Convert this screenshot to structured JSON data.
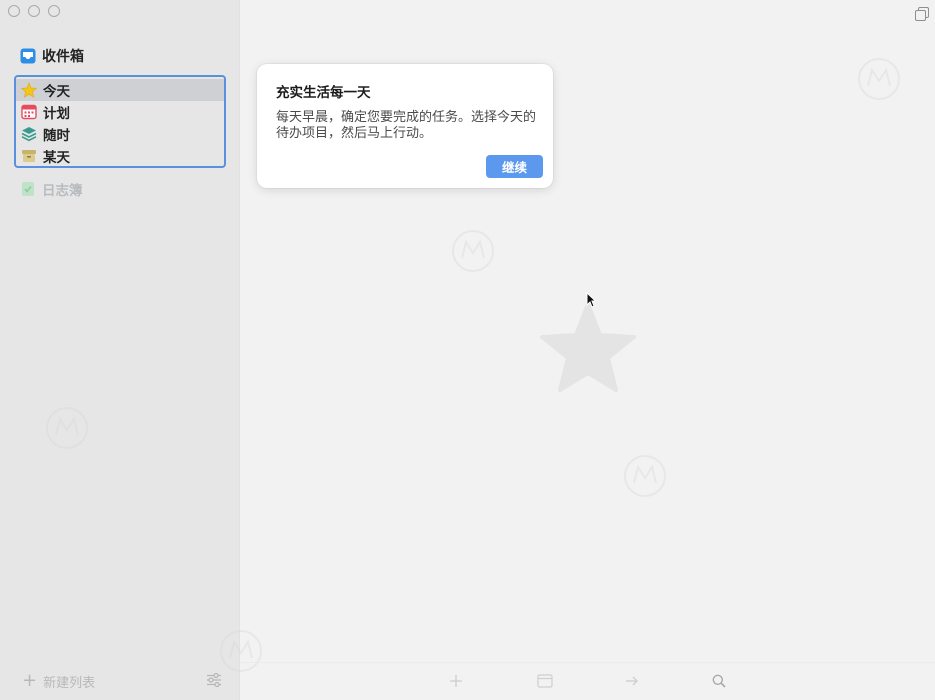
{
  "sidebar": {
    "inbox": {
      "label": "收件箱",
      "icon": "inbox-tray-icon",
      "color": "#2c8ee6"
    },
    "items": [
      {
        "label": "今天",
        "icon": "star-icon",
        "color": "#f5c518",
        "selected": true
      },
      {
        "label": "计划",
        "icon": "calendar-icon",
        "color": "#e84a5f"
      },
      {
        "label": "随时",
        "icon": "layers-icon",
        "color": "#3a9a8f"
      },
      {
        "label": "某天",
        "icon": "archive-box-icon",
        "color": "#c9b36b"
      }
    ],
    "logbook": {
      "label": "日志簿",
      "icon": "logbook-icon",
      "color": "#a7d9b3"
    },
    "footer": {
      "new_list_label": "新建列表"
    }
  },
  "popover": {
    "title": "充实生活每一天",
    "body": "每天早晨，确定您要完成的任务。选择今天的待办项目，然后马上行动。",
    "continue_label": "继续"
  },
  "colors": {
    "accent": "#5b98ee",
    "selection_border": "#5b8fe0",
    "sidebar_bg": "#e6e6e7",
    "main_bg": "#f2f2f2"
  }
}
